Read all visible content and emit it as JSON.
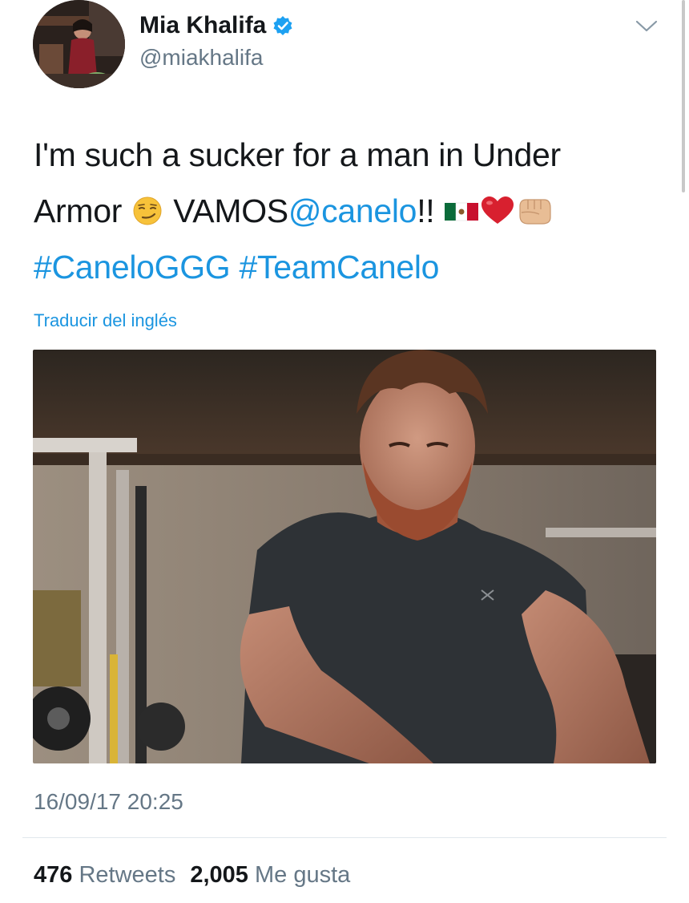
{
  "user": {
    "display_name": "Mia Khalifa",
    "handle": "@miakhalifa",
    "verified": true
  },
  "tweet": {
    "line1": "I'm such a sucker for a man in Under",
    "armor_word": "Armor",
    "vamos_word": "VAMOS",
    "mention": "@canelo",
    "exclaim": "!!",
    "hashtag1": "#CaneloGGG",
    "hashtag2": "#TeamCanelo",
    "emojis": [
      "smirking-face",
      "mexico-flag",
      "red-heart",
      "oncoming-fist"
    ]
  },
  "translate_link": "Traducir del inglés",
  "media": {
    "icon": "photo-of-man-in-gym"
  },
  "timestamp": "16/09/17 20:25",
  "stats": {
    "retweets_count": "476",
    "retweets_label": "Retweets",
    "likes_count": "2,005",
    "likes_label": "Me gusta"
  },
  "colors": {
    "link": "#1b95e0",
    "text": "#14171a",
    "secondary": "#657786",
    "divider": "#e1e8ed"
  }
}
